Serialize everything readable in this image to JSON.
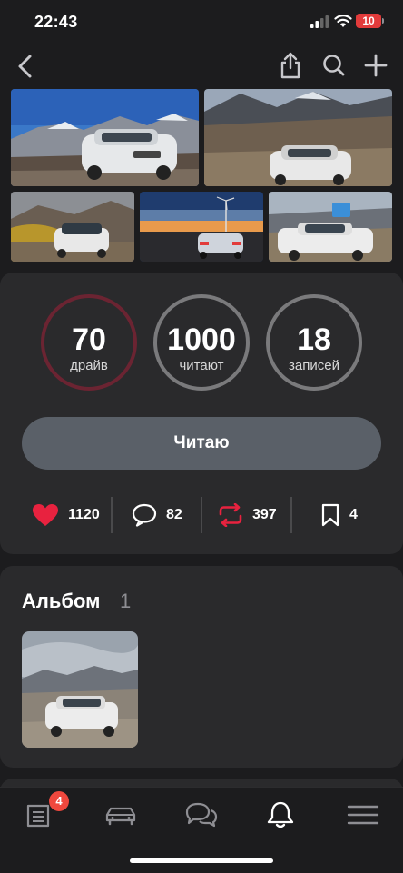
{
  "status_bar": {
    "time": "22:43",
    "battery": "10"
  },
  "stats": [
    {
      "value": "70",
      "label": "драйв"
    },
    {
      "value": "1000",
      "label": "читают"
    },
    {
      "value": "18",
      "label": "записей"
    }
  ],
  "follow_button": "Читаю",
  "actions": {
    "likes": "1120",
    "comments": "82",
    "reposts": "397",
    "bookmarks": "4"
  },
  "album": {
    "title": "Альбом",
    "count": "1"
  },
  "tabbar": {
    "badge": "4"
  },
  "colors": {
    "background": "#1c1c1e",
    "card": "#2a2a2c",
    "accent_red": "#e8223f",
    "button": "#5a6068"
  },
  "icons": [
    "back-icon",
    "share-icon",
    "search-icon",
    "plus-icon",
    "heart-icon",
    "comment-icon",
    "repost-icon",
    "bookmark-icon",
    "feed-icon",
    "car-icon",
    "chat-icon",
    "bell-icon",
    "menu-icon"
  ]
}
